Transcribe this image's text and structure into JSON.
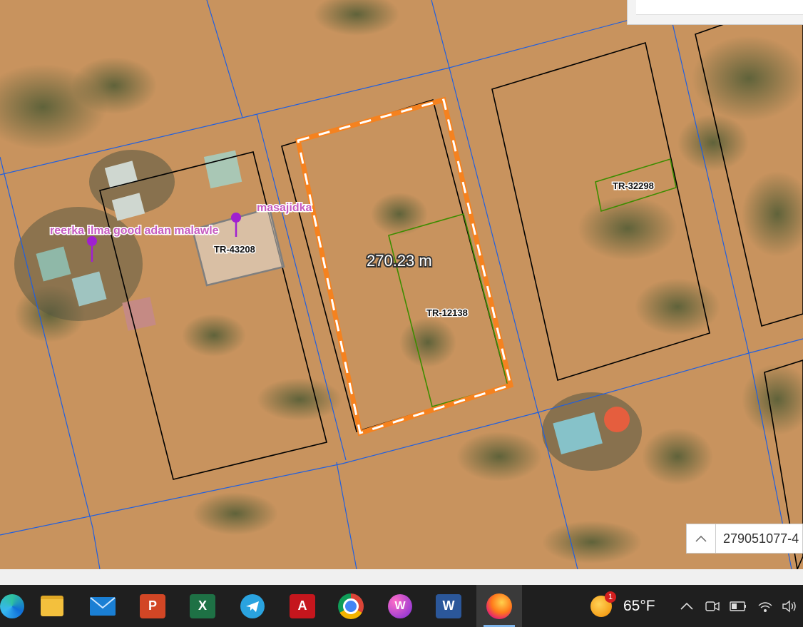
{
  "map": {
    "parcels": [
      {
        "id": "TR-43208",
        "label": "TR-43208"
      },
      {
        "id": "TR-12138",
        "label": "TR-12138"
      },
      {
        "id": "TR-32298",
        "label": "TR-32298"
      }
    ],
    "pois": [
      {
        "label": "reerka ilma good adan malawle"
      },
      {
        "label": "masajidka"
      }
    ],
    "measurement": {
      "label": "270.23 m",
      "value": 270.23,
      "unit": "m"
    },
    "colors": {
      "grid_lines": "#1f5fe0",
      "parcel_outline": "#000000",
      "plot_outline": "#3d8c00",
      "measure_orange": "#f5821f",
      "measure_white": "#ffffff",
      "poi_marker": "#a020d0"
    }
  },
  "coordinate_box": {
    "toggle_icon": "caret-up-icon",
    "value": "279051077-4"
  },
  "taskbar": {
    "apps": [
      {
        "name": "edge",
        "icon": "edge-icon"
      },
      {
        "name": "file-explorer",
        "icon": "folder-icon"
      },
      {
        "name": "mail",
        "icon": "mail-icon"
      },
      {
        "name": "powerpoint",
        "icon": "powerpoint-icon"
      },
      {
        "name": "excel",
        "icon": "excel-icon"
      },
      {
        "name": "telegram",
        "icon": "telegram-icon"
      },
      {
        "name": "autocad",
        "icon": "autocad-icon"
      },
      {
        "name": "chrome",
        "icon": "chrome-icon"
      },
      {
        "name": "video-editor",
        "icon": "video-editor-icon"
      },
      {
        "name": "word",
        "icon": "word-icon"
      },
      {
        "name": "firefox",
        "icon": "firefox-icon",
        "active": true
      }
    ],
    "weather": {
      "badge": "1",
      "temperature": "65°F"
    }
  }
}
